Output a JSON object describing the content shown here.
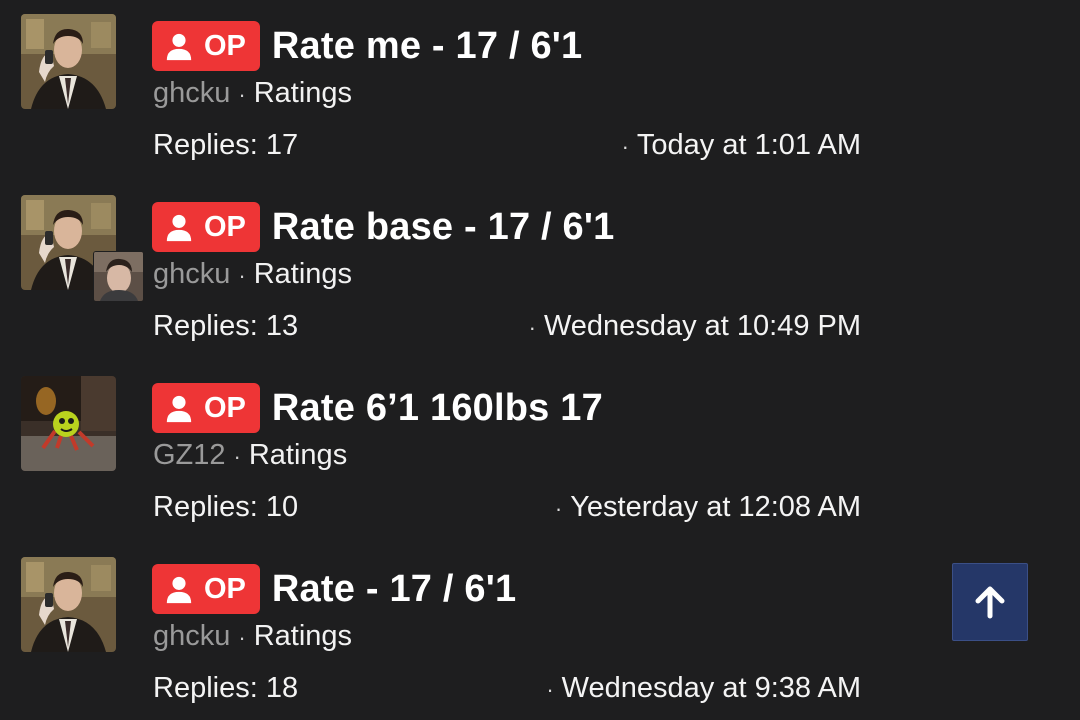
{
  "threads": [
    {
      "badge": "OP",
      "title": "Rate me - 17 / 6'1",
      "author": "ghcku",
      "separator": "·",
      "forum": "Ratings",
      "replies": "Replies: 17",
      "last_post": "Today at 1:01 AM",
      "avatar_icon": "man-on-phone-avatar"
    },
    {
      "badge": "OP",
      "title": "Rate base - 17 / 6'1",
      "author": "ghcku",
      "separator": "·",
      "forum": "Ratings",
      "replies": "Replies: 13",
      "last_post": "Wednesday at 10:49 PM",
      "avatar_icon": "man-on-phone-avatar",
      "last_poster_icon": "young-man-avatar"
    },
    {
      "badge": "OP",
      "title": "Rate 6’1 160lbs 17",
      "author": "GZ12",
      "separator": "·",
      "forum": "Ratings",
      "replies": "Replies: 10",
      "last_post": "Yesterday at 12:08 AM",
      "avatar_icon": "green-ball-character-avatar"
    },
    {
      "badge": "OP",
      "title": "Rate - 17 / 6'1",
      "author": "ghcku",
      "separator": "·",
      "forum": "Ratings",
      "replies": "Replies: 18",
      "last_post": "Wednesday at 9:38 AM",
      "avatar_icon": "man-on-phone-avatar"
    }
  ],
  "scroll_top_icon": "arrow-up-icon",
  "colors": {
    "background": "#1e1e1f",
    "op_badge": "#ee3536",
    "author": "#9a9a9a",
    "scroll_button": "#253768"
  }
}
